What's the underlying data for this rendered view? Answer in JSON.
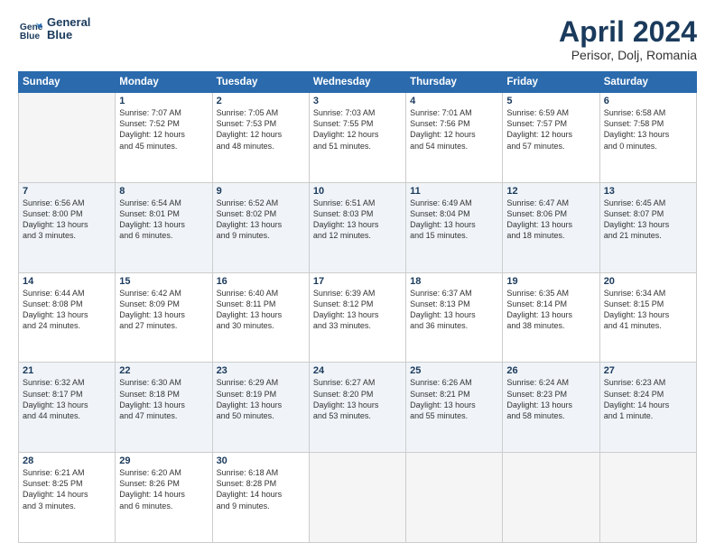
{
  "header": {
    "logo_line1": "General",
    "logo_line2": "Blue",
    "title": "April 2024",
    "subtitle": "Perisor, Dolj, Romania"
  },
  "columns": [
    "Sunday",
    "Monday",
    "Tuesday",
    "Wednesday",
    "Thursday",
    "Friday",
    "Saturday"
  ],
  "weeks": [
    [
      {
        "day": "",
        "detail": ""
      },
      {
        "day": "1",
        "detail": "Sunrise: 7:07 AM\nSunset: 7:52 PM\nDaylight: 12 hours\nand 45 minutes."
      },
      {
        "day": "2",
        "detail": "Sunrise: 7:05 AM\nSunset: 7:53 PM\nDaylight: 12 hours\nand 48 minutes."
      },
      {
        "day": "3",
        "detail": "Sunrise: 7:03 AM\nSunset: 7:55 PM\nDaylight: 12 hours\nand 51 minutes."
      },
      {
        "day": "4",
        "detail": "Sunrise: 7:01 AM\nSunset: 7:56 PM\nDaylight: 12 hours\nand 54 minutes."
      },
      {
        "day": "5",
        "detail": "Sunrise: 6:59 AM\nSunset: 7:57 PM\nDaylight: 12 hours\nand 57 minutes."
      },
      {
        "day": "6",
        "detail": "Sunrise: 6:58 AM\nSunset: 7:58 PM\nDaylight: 13 hours\nand 0 minutes."
      }
    ],
    [
      {
        "day": "7",
        "detail": "Sunrise: 6:56 AM\nSunset: 8:00 PM\nDaylight: 13 hours\nand 3 minutes."
      },
      {
        "day": "8",
        "detail": "Sunrise: 6:54 AM\nSunset: 8:01 PM\nDaylight: 13 hours\nand 6 minutes."
      },
      {
        "day": "9",
        "detail": "Sunrise: 6:52 AM\nSunset: 8:02 PM\nDaylight: 13 hours\nand 9 minutes."
      },
      {
        "day": "10",
        "detail": "Sunrise: 6:51 AM\nSunset: 8:03 PM\nDaylight: 13 hours\nand 12 minutes."
      },
      {
        "day": "11",
        "detail": "Sunrise: 6:49 AM\nSunset: 8:04 PM\nDaylight: 13 hours\nand 15 minutes."
      },
      {
        "day": "12",
        "detail": "Sunrise: 6:47 AM\nSunset: 8:06 PM\nDaylight: 13 hours\nand 18 minutes."
      },
      {
        "day": "13",
        "detail": "Sunrise: 6:45 AM\nSunset: 8:07 PM\nDaylight: 13 hours\nand 21 minutes."
      }
    ],
    [
      {
        "day": "14",
        "detail": "Sunrise: 6:44 AM\nSunset: 8:08 PM\nDaylight: 13 hours\nand 24 minutes."
      },
      {
        "day": "15",
        "detail": "Sunrise: 6:42 AM\nSunset: 8:09 PM\nDaylight: 13 hours\nand 27 minutes."
      },
      {
        "day": "16",
        "detail": "Sunrise: 6:40 AM\nSunset: 8:11 PM\nDaylight: 13 hours\nand 30 minutes."
      },
      {
        "day": "17",
        "detail": "Sunrise: 6:39 AM\nSunset: 8:12 PM\nDaylight: 13 hours\nand 33 minutes."
      },
      {
        "day": "18",
        "detail": "Sunrise: 6:37 AM\nSunset: 8:13 PM\nDaylight: 13 hours\nand 36 minutes."
      },
      {
        "day": "19",
        "detail": "Sunrise: 6:35 AM\nSunset: 8:14 PM\nDaylight: 13 hours\nand 38 minutes."
      },
      {
        "day": "20",
        "detail": "Sunrise: 6:34 AM\nSunset: 8:15 PM\nDaylight: 13 hours\nand 41 minutes."
      }
    ],
    [
      {
        "day": "21",
        "detail": "Sunrise: 6:32 AM\nSunset: 8:17 PM\nDaylight: 13 hours\nand 44 minutes."
      },
      {
        "day": "22",
        "detail": "Sunrise: 6:30 AM\nSunset: 8:18 PM\nDaylight: 13 hours\nand 47 minutes."
      },
      {
        "day": "23",
        "detail": "Sunrise: 6:29 AM\nSunset: 8:19 PM\nDaylight: 13 hours\nand 50 minutes."
      },
      {
        "day": "24",
        "detail": "Sunrise: 6:27 AM\nSunset: 8:20 PM\nDaylight: 13 hours\nand 53 minutes."
      },
      {
        "day": "25",
        "detail": "Sunrise: 6:26 AM\nSunset: 8:21 PM\nDaylight: 13 hours\nand 55 minutes."
      },
      {
        "day": "26",
        "detail": "Sunrise: 6:24 AM\nSunset: 8:23 PM\nDaylight: 13 hours\nand 58 minutes."
      },
      {
        "day": "27",
        "detail": "Sunrise: 6:23 AM\nSunset: 8:24 PM\nDaylight: 14 hours\nand 1 minute."
      }
    ],
    [
      {
        "day": "28",
        "detail": "Sunrise: 6:21 AM\nSunset: 8:25 PM\nDaylight: 14 hours\nand 3 minutes."
      },
      {
        "day": "29",
        "detail": "Sunrise: 6:20 AM\nSunset: 8:26 PM\nDaylight: 14 hours\nand 6 minutes."
      },
      {
        "day": "30",
        "detail": "Sunrise: 6:18 AM\nSunset: 8:28 PM\nDaylight: 14 hours\nand 9 minutes."
      },
      {
        "day": "",
        "detail": ""
      },
      {
        "day": "",
        "detail": ""
      },
      {
        "day": "",
        "detail": ""
      },
      {
        "day": "",
        "detail": ""
      }
    ]
  ]
}
